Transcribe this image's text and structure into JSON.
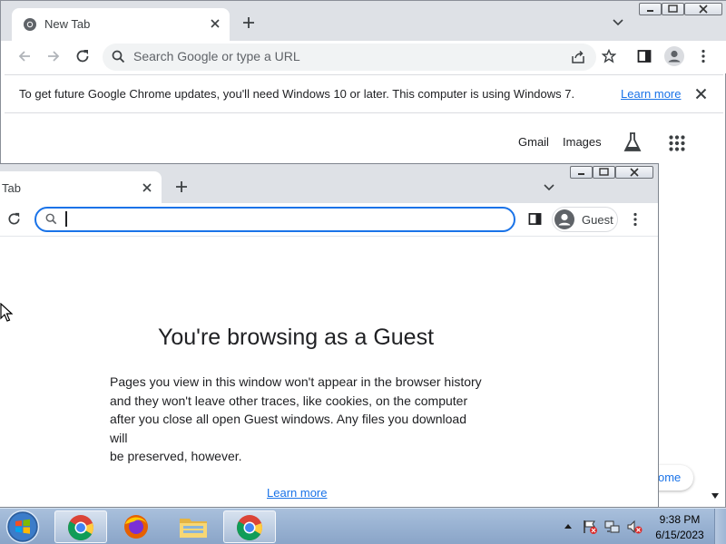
{
  "back_window": {
    "tab_title": "New Tab",
    "omnibox_placeholder": "Search Google or type a URL",
    "infobar_message": "To get future Google Chrome updates, you'll need Windows 10 or later. This computer is using Windows 7.",
    "infobar_link": "Learn more",
    "ntp_links": [
      "Gmail",
      "Images"
    ]
  },
  "front_window": {
    "tab_title": "Tab",
    "profile_label": "Guest",
    "heading": "You're browsing as a Guest",
    "body_lines": [
      "Pages you view in this window won't appear in the browser history",
      "and they won't leave other traces, like cookies, on the computer",
      "after you close all open Guest windows. Any files you download will",
      "be preserved, however."
    ],
    "learn_more": "Learn more",
    "hidden_chip_fragment": "ome"
  },
  "taskbar": {
    "apps": [
      "chrome-icon",
      "firefox-icon",
      "file-explorer-icon",
      "chrome-icon"
    ],
    "clock_time": "9:38 PM",
    "clock_date": "6/15/2023"
  },
  "colors": {
    "accent": "#1a73e8",
    "tabstrip": "#dee1e6",
    "taskbar": "#9ab3d3"
  }
}
